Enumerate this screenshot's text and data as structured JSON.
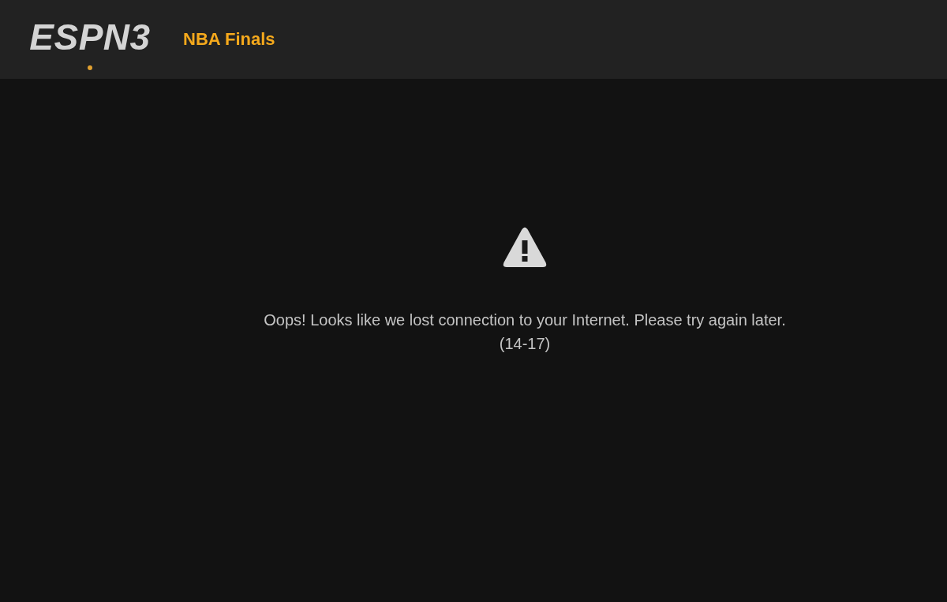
{
  "header": {
    "logo": "ESPN3",
    "title": "NBA Finals"
  },
  "error": {
    "message": "Oops! Looks like we lost connection to your Internet. Please try again later.",
    "code": "(14-17)"
  }
}
